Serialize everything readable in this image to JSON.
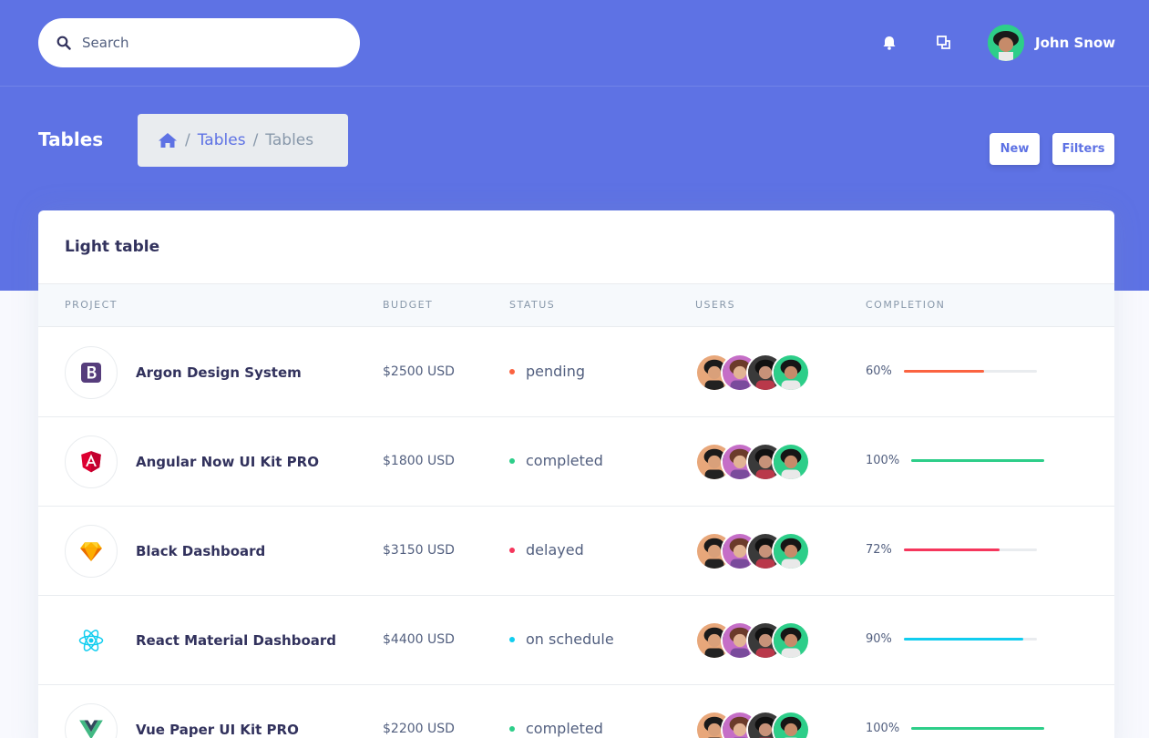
{
  "header": {
    "search_placeholder": "Search",
    "user_name": "John Snow"
  },
  "page": {
    "title": "Tables",
    "breadcrumb": [
      "Tables",
      "Tables"
    ],
    "actions": {
      "new_label": "New",
      "filters_label": "Filters"
    }
  },
  "card": {
    "title": "Light table",
    "columns": [
      "Project",
      "Budget",
      "Status",
      "Users",
      "Completion"
    ],
    "rows": [
      {
        "name": "Argon Design System",
        "budget": "$2500 USD",
        "status": "pending",
        "status_color": "#fb6340",
        "completion_label": "60%",
        "completion": 0.6,
        "bar_color": "#fb6340",
        "logo": "bootstrap-icon"
      },
      {
        "name": "Angular Now UI Kit PRO",
        "budget": "$1800 USD",
        "status": "completed",
        "status_color": "#2dce89",
        "completion_label": "100%",
        "completion": 1.0,
        "bar_color": "#2dce89",
        "logo": "angular-icon"
      },
      {
        "name": "Black Dashboard",
        "budget": "$3150 USD",
        "status": "delayed",
        "status_color": "#f5365c",
        "completion_label": "72%",
        "completion": 0.72,
        "bar_color": "#f5365c",
        "logo": "sketch-icon"
      },
      {
        "name": "React Material Dashboard",
        "budget": "$4400 USD",
        "status": "on schedule",
        "status_color": "#11cdef",
        "completion_label": "90%",
        "completion": 0.9,
        "bar_color": "#11cdef",
        "logo": "react-icon"
      },
      {
        "name": "Vue Paper UI Kit PRO",
        "budget": "$2200 USD",
        "status": "completed",
        "status_color": "#2dce89",
        "completion_label": "100%",
        "completion": 1.0,
        "bar_color": "#2dce89",
        "logo": "vue-icon"
      }
    ]
  },
  "colors": {
    "primary": "#5e72e4",
    "background": "#f8f9fe"
  }
}
